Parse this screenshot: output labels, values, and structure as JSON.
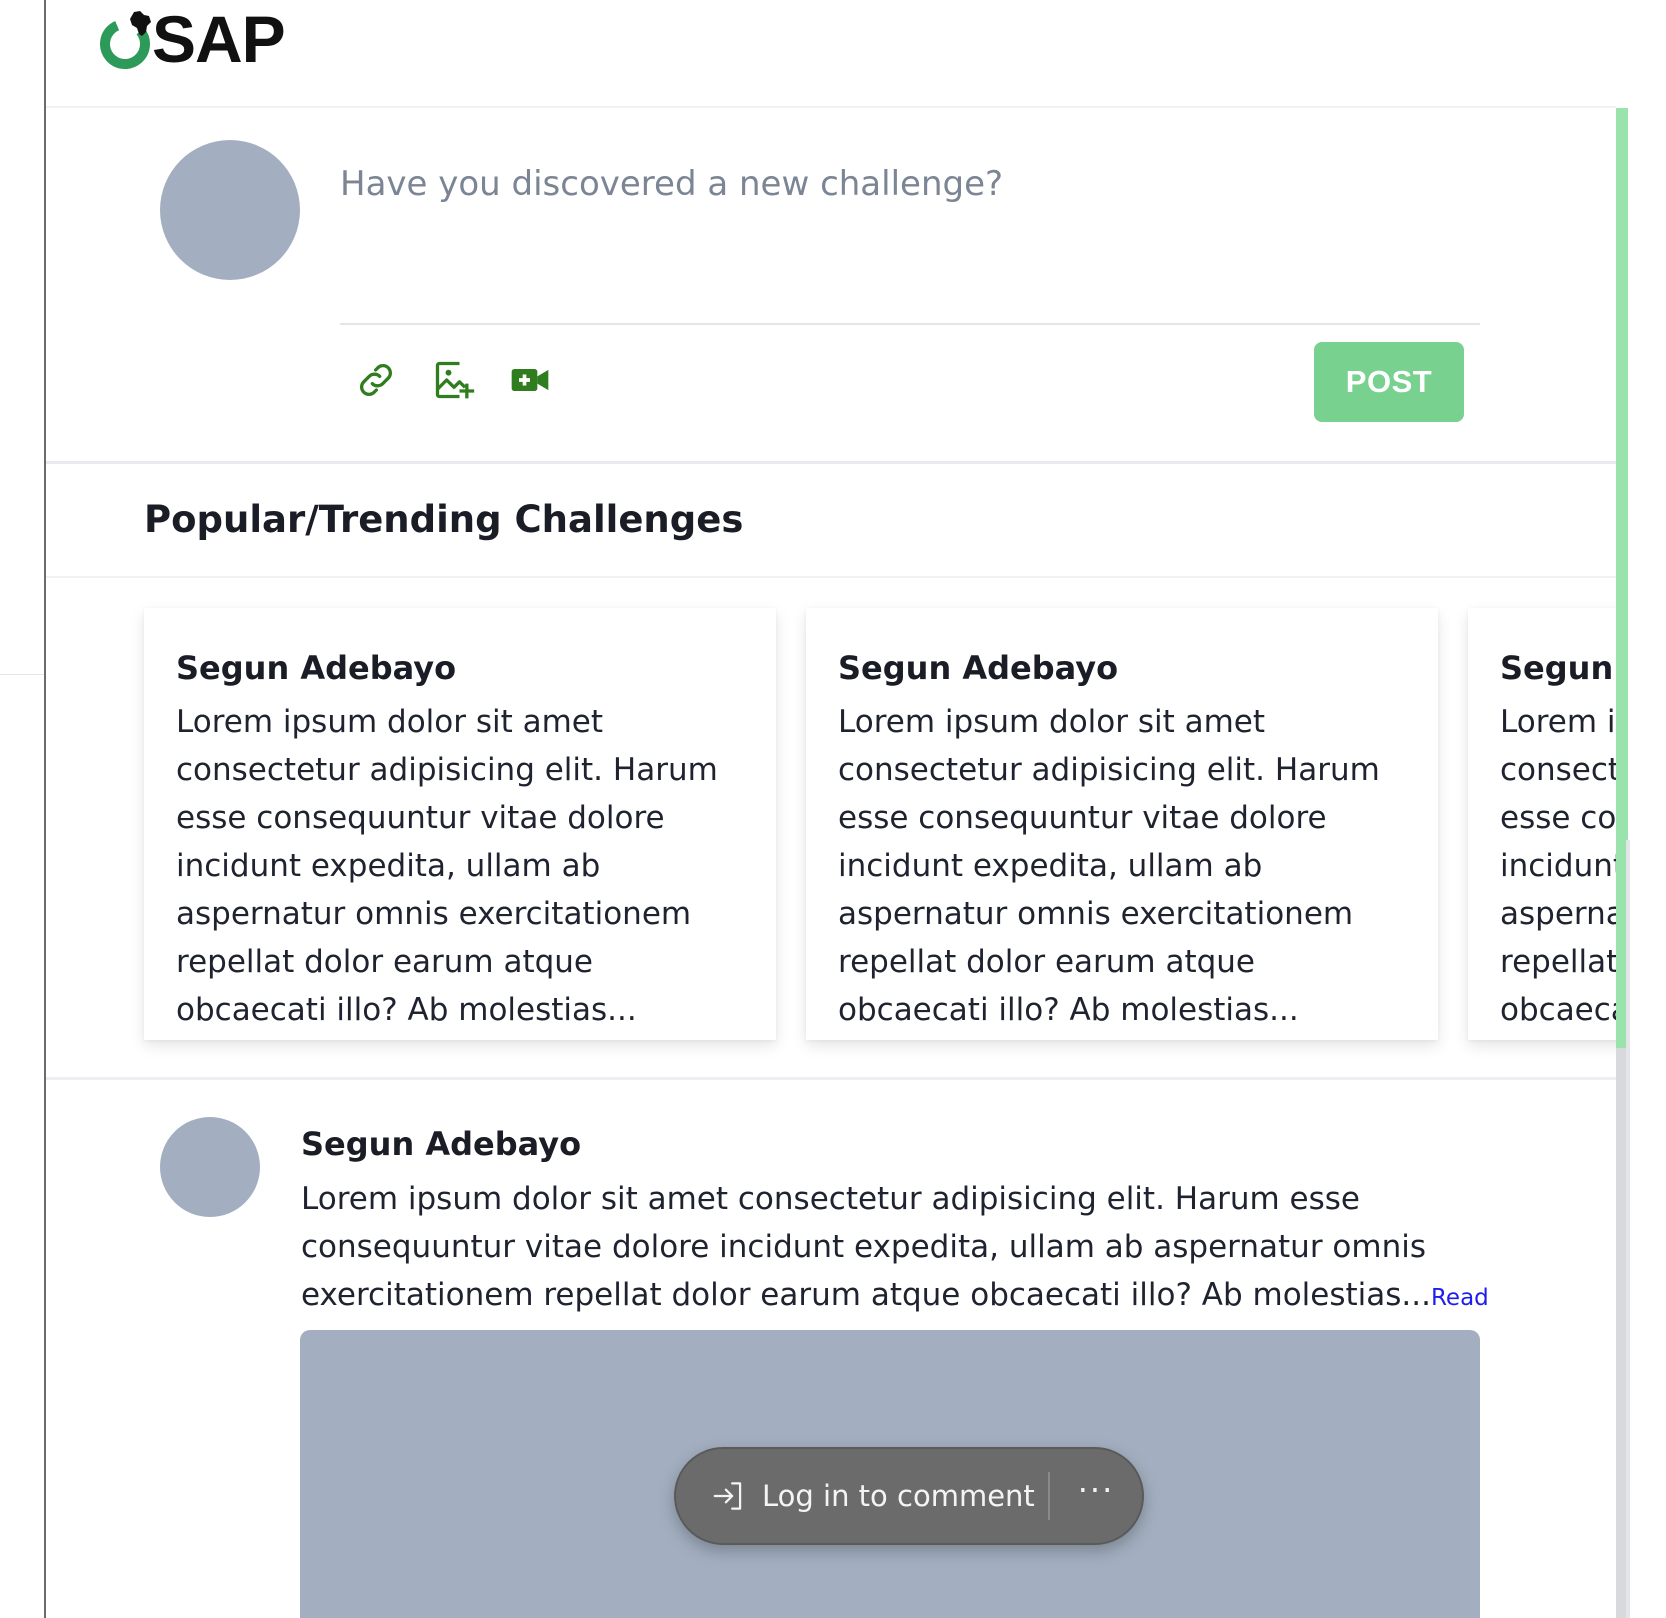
{
  "app": {
    "logo_text": "SAP"
  },
  "composer": {
    "placeholder": "Have you discovered a new challenge?",
    "tools": [
      "link-icon",
      "add-image-icon",
      "add-video-icon"
    ],
    "post_label": "POST"
  },
  "trending": {
    "title": "Popular/Trending Challenges",
    "cards": [
      {
        "author": "Segun Adebayo",
        "excerpt": "Lorem ipsum dolor sit amet consectetur adipisicing elit. Harum esse consequuntur vitae dolore incidunt expedita, ullam ab aspernatur omnis exercitationem repellat dolor earum atque obcaecati illo? Ab molestias..."
      },
      {
        "author": "Segun Adebayo",
        "excerpt": "Lorem ipsum dolor sit amet consectetur adipisicing elit. Harum esse consequuntur vitae dolore incidunt expedita, ullam ab aspernatur omnis exercitationem repellat dolor earum atque obcaecati illo? Ab molestias..."
      },
      {
        "author": "Segun Adebayo",
        "excerpt": "Lorem ipsum dolor sit amet consectetur adipisicing elit. Harum esse consequuntur vitae dolore incidunt expedita, ullam ab aspernatur omnis exercitationem repellat dolor earum atque obcaecati illo? Ab molestias..."
      }
    ]
  },
  "feed": {
    "post": {
      "author": "Segun Adebayo",
      "text": "Lorem ipsum dolor sit amet consectetur adipisicing elit. Harum esse consequuntur vitae dolore incidunt expedita, ullam ab aspernatur omnis exercitationem repellat dolor earum atque obcaecati illo? Ab molestias...",
      "read_more": "Read more"
    }
  },
  "login_prompt": {
    "label": "Log in to comment",
    "more": "···"
  },
  "colors": {
    "brand_green": "#2e9a5a",
    "post_button": "#78d18f",
    "icon_green": "#2f7d1f",
    "avatar_placeholder": "#a3afc0",
    "link": "#1d1df0"
  }
}
